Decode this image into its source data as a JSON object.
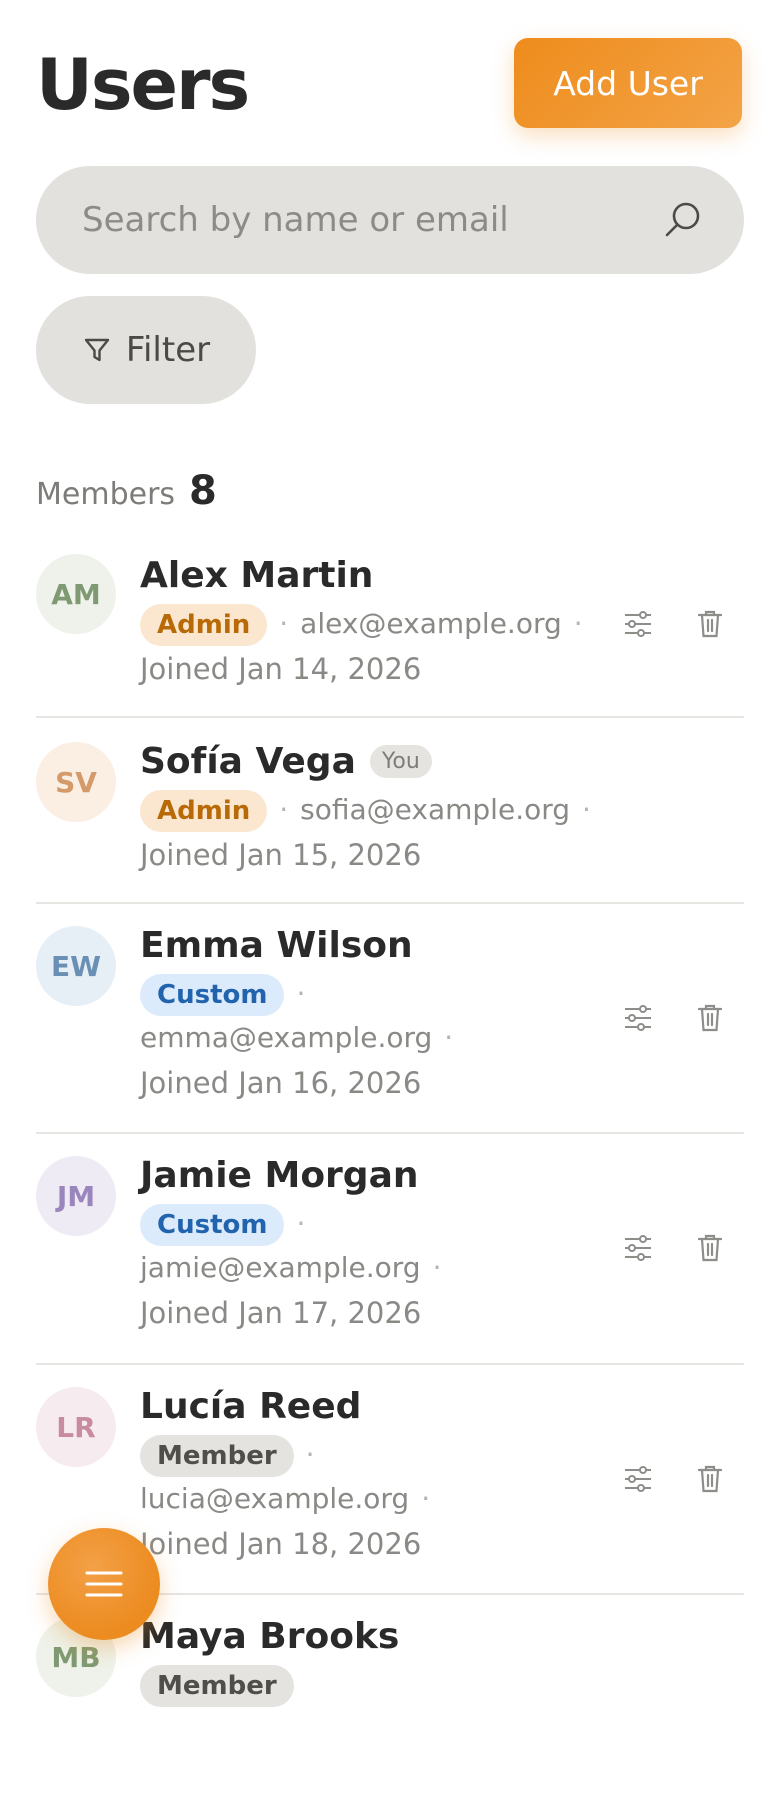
{
  "header": {
    "title": "Users",
    "add_button_label": "Add User"
  },
  "search": {
    "placeholder": "Search by name or email",
    "value": ""
  },
  "filter": {
    "label": "Filter"
  },
  "members": {
    "label": "Members",
    "count": "8"
  },
  "users": [
    {
      "initials": "AM",
      "name": "Alex Martin",
      "you_label": "",
      "role": "Admin",
      "email": "alex@example.org",
      "joined": "Joined Jan 14, 2026",
      "avatar_bg": "#eef2ea",
      "avatar_fg": "#7f9a72",
      "role_bg": "#fbe7cf",
      "role_fg": "#b86a06",
      "show_actions": true
    },
    {
      "initials": "SV",
      "name": "Sofía Vega",
      "you_label": "You",
      "role": "Admin",
      "email": "sofia@example.org",
      "joined": "Joined Jan 15, 2026",
      "avatar_bg": "#fbeee3",
      "avatar_fg": "#d49a6a",
      "role_bg": "#fbe7cf",
      "role_fg": "#b86a06",
      "show_actions": false
    },
    {
      "initials": "EW",
      "name": "Emma Wilson",
      "you_label": "",
      "role": "Custom",
      "email": "emma@example.org",
      "joined": "Joined Jan 16, 2026",
      "avatar_bg": "#e6eef6",
      "avatar_fg": "#6a8fb4",
      "role_bg": "#dcebfb",
      "role_fg": "#2263ae",
      "show_actions": true
    },
    {
      "initials": "JM",
      "name": "Jamie Morgan",
      "you_label": "",
      "role": "Custom",
      "email": "jamie@example.org",
      "joined": "Joined Jan 17, 2026",
      "avatar_bg": "#efebf5",
      "avatar_fg": "#9a86bd",
      "role_bg": "#dcebfb",
      "role_fg": "#2263ae",
      "show_actions": true
    },
    {
      "initials": "LR",
      "name": "Lucía Reed",
      "you_label": "",
      "role": "Member",
      "email": "lucia@example.org",
      "joined": "Joined Jan 18, 2026",
      "avatar_bg": "#f6ecef",
      "avatar_fg": "#c98ba0",
      "role_bg": "#e4e3e0",
      "role_fg": "#4f4e4b",
      "show_actions": true
    },
    {
      "initials": "MB",
      "name": "Maya Brooks",
      "you_label": "",
      "role": "Member",
      "email": "",
      "joined": "",
      "avatar_bg": "#eef2ea",
      "avatar_fg": "#7f9a72",
      "role_bg": "#e4e3e0",
      "role_fg": "#4f4e4b",
      "show_actions": false
    }
  ],
  "colors": {
    "accent": "#ee8c1c",
    "surface": "#e2e1de",
    "divider": "#e6e5e2"
  },
  "icons": {
    "search": "search-icon",
    "filter": "filter-icon",
    "permissions": "sliders-icon",
    "delete": "trash-icon",
    "menu": "menu-icon"
  }
}
